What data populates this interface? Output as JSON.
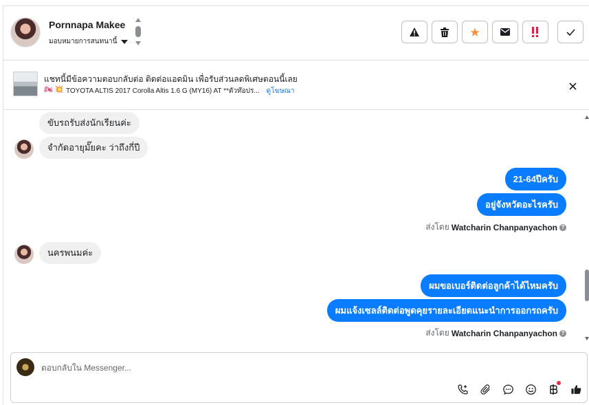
{
  "header": {
    "contact_name": "Pornnapa Makee",
    "assign_label": "มอบหมายการสนทนานี้"
  },
  "actions": [
    {
      "name": "report-icon",
      "glyph": "⚠"
    },
    {
      "name": "trash-icon",
      "glyph": "🗑"
    },
    {
      "name": "star-icon",
      "glyph": "★",
      "color": "#f7923b"
    },
    {
      "name": "mail-icon",
      "glyph": "✉"
    },
    {
      "name": "important-icon",
      "glyph": "!!",
      "color": "#e41e3f"
    },
    {
      "name": "done-icon",
      "glyph": "✓"
    }
  ],
  "ad": {
    "title": "แชทนี้มีข้อความตอบกลับต่อ ติดต่อแอดมิน เพื่อรับส่วนลดพิเศษตอนนี้เลย",
    "emoji": "🏍 💥",
    "subtitle": "TOYOTA ALTIS 2017 Corolla Altis 1.6 G (MY16) AT **ตัวท๊อปร...",
    "link": "ดูโฆษณา"
  },
  "messages": {
    "in1": "ขับรถรับส่งนักเรียนค่ะ",
    "in2": "จำกัดอายุมั๊ยคะ ว่าถึงกี่ปี",
    "out1": "21-64ปีครับ",
    "out2": "อยู่จังหวัดอะไรครับ",
    "in3": "นครพนมค่ะ",
    "out3": "ผมขอเบอร์ติดต่อลูกค้าได้ไหมครับ",
    "out4": "ผมแจ้งเซลล์ติดต่อพูดคุยรายละเอียดแนะนำการออกรถครับ"
  },
  "sent_by": {
    "prefix": "ส่งโดย",
    "agent": "Watcharin Chanpanyachon"
  },
  "composer": {
    "placeholder": "ตอบกลับใน Messenger..."
  },
  "colors": {
    "outgoing_bubble": "#0a7cff",
    "incoming_bubble": "#f0f0f0",
    "link": "#1877f2"
  }
}
